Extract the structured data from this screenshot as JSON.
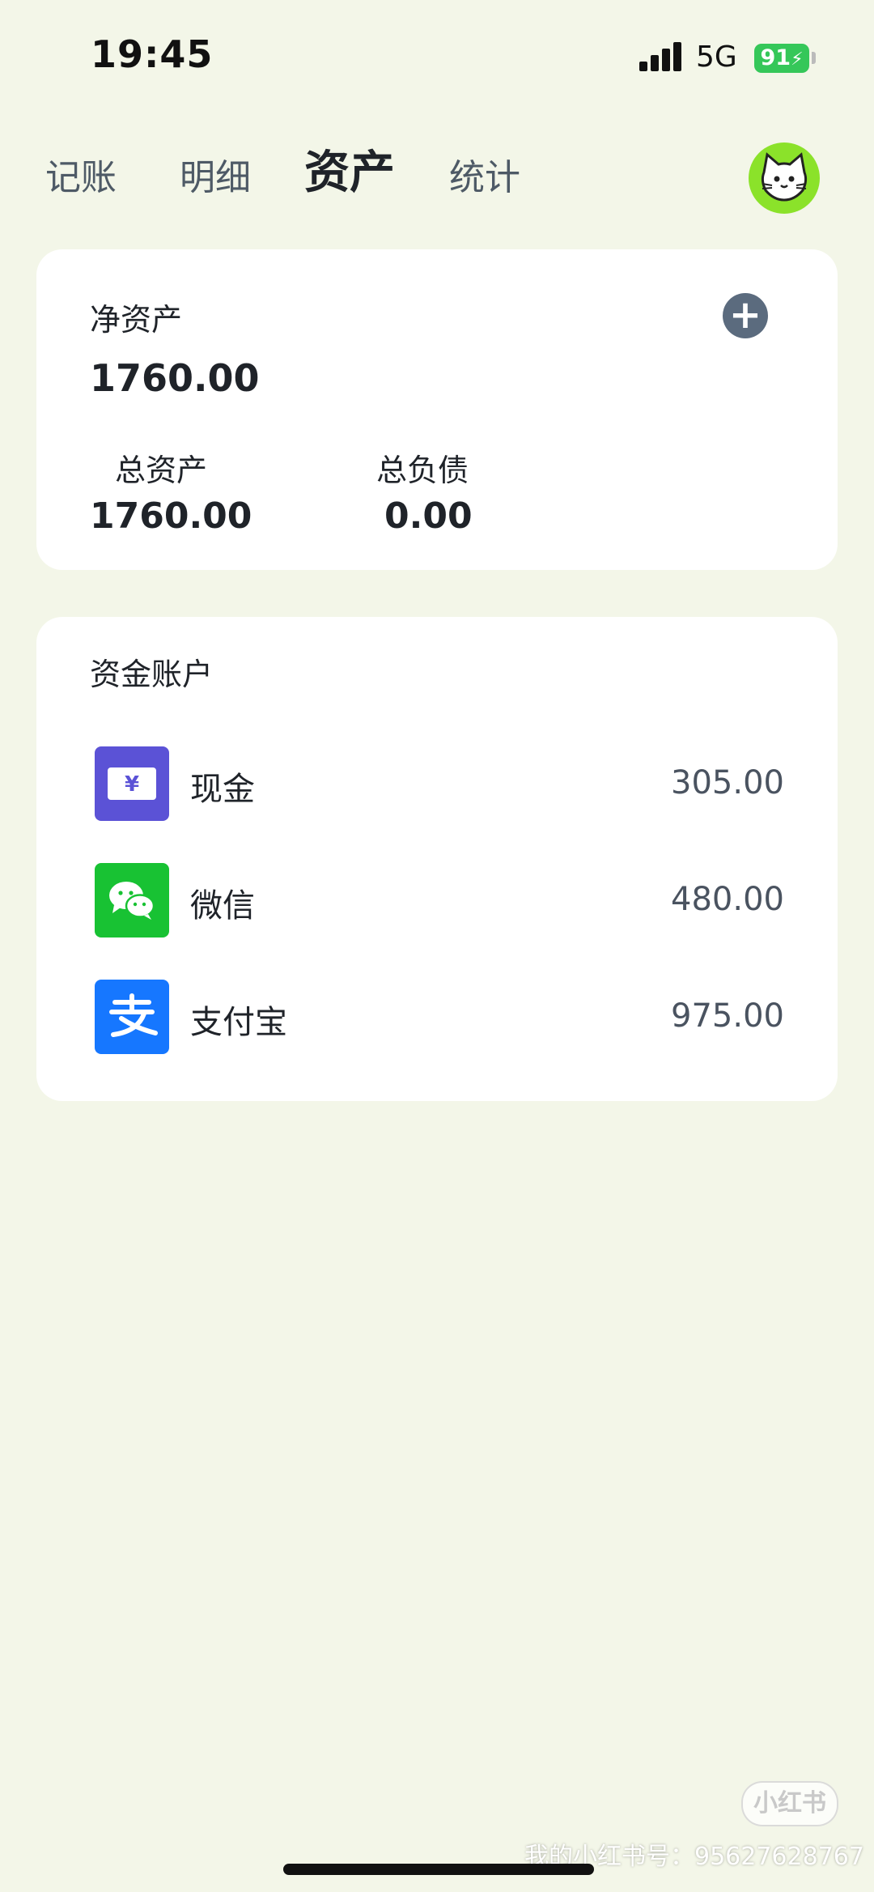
{
  "status_bar": {
    "time": "19:45",
    "network": "5G",
    "battery": "91"
  },
  "tabs": [
    {
      "label": "记账",
      "active": false
    },
    {
      "label": "明细",
      "active": false
    },
    {
      "label": "资产",
      "active": true
    },
    {
      "label": "统计",
      "active": false
    }
  ],
  "net_assets": {
    "label": "净资产",
    "value": "1760.00",
    "total_assets_label": "总资产",
    "total_assets_value": "1760.00",
    "total_liabilities_label": "总负债",
    "total_liabilities_value": "0.00"
  },
  "accounts": {
    "title": "资金账户",
    "items": [
      {
        "name": "现金",
        "amount": "305.00",
        "icon": "cash-icon",
        "color": "#5b52d6"
      },
      {
        "name": "微信",
        "amount": "480.00",
        "icon": "wechat-icon",
        "color": "#18c233"
      },
      {
        "name": "支付宝",
        "amount": "975.00",
        "icon": "alipay-icon",
        "color": "#1677ff"
      }
    ]
  },
  "watermark": {
    "badge": "小红书",
    "text": "我的小红书号：9562762876​7"
  },
  "colors": {
    "background": "#f3f6e8",
    "card": "#ffffff",
    "avatar_ring": "#8be22a",
    "add_button": "#5b6b7e"
  }
}
